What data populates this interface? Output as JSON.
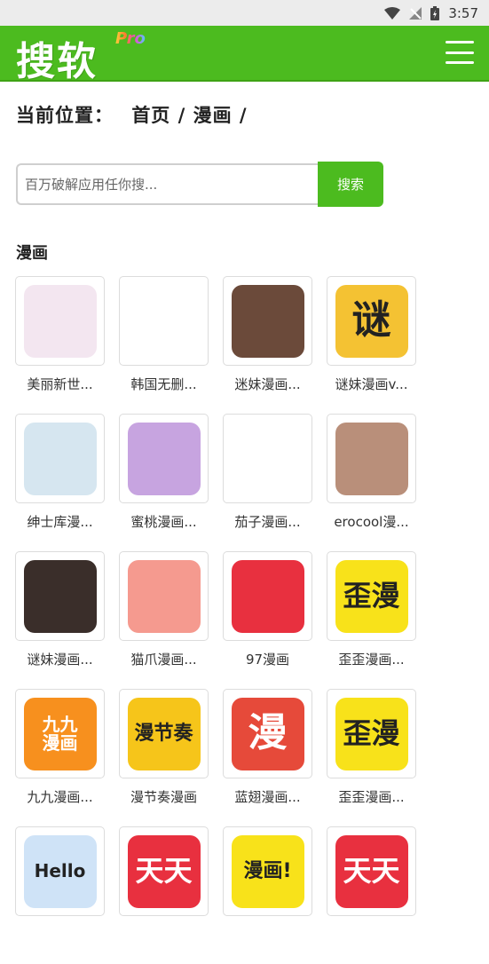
{
  "status_bar": {
    "time": "3:57"
  },
  "header": {
    "logo": "搜软",
    "logo_badge": "Pro"
  },
  "breadcrumb": {
    "prefix": "当前位置：",
    "home": "首页",
    "sep1": "/",
    "category": "漫画",
    "sep2": "/"
  },
  "search": {
    "placeholder": "百万破解应用任你搜...",
    "button": "搜索"
  },
  "section": {
    "title": "漫画"
  },
  "apps": [
    {
      "label": "美丽新世...",
      "icon": "anime-girl-white-hair-icon",
      "bg": "#f3e6f0",
      "glyph": "",
      "color": "#f3e6f0"
    },
    {
      "label": "韩国无删...",
      "icon": "korean-comic-logo-icon",
      "bg": "#ffffff",
      "glyph": "",
      "color": "#ffffff"
    },
    {
      "label": "迷妹漫画...",
      "icon": "anime-girl-library-icon",
      "bg": "#6b4a3a",
      "glyph": "",
      "color": "#6b4a3a"
    },
    {
      "label": "谜妹漫画v...",
      "icon": "mimei-monkey-logo-icon",
      "bg": "#f4c233",
      "glyph": "谜",
      "color": "#f4c233"
    },
    {
      "label": "绅士库漫...",
      "icon": "anime-girl-dark-hair-icon",
      "bg": "#d6e6f0",
      "glyph": "",
      "color": "#d6e6f0"
    },
    {
      "label": "蜜桃漫画...",
      "icon": "peach-mascot-icon",
      "bg": "#c7a4e0",
      "glyph": "",
      "color": "#c7a4e0"
    },
    {
      "label": "茄子漫画...",
      "icon": "eggplant-mascot-icon",
      "bg": "#ffffff",
      "glyph": "",
      "color": "#ffffff"
    },
    {
      "label": "erocool漫...",
      "icon": "anime-girl-uniform-icon",
      "bg": "#b98f7a",
      "glyph": "",
      "color": "#b98f7a"
    },
    {
      "label": "谜妹漫画...",
      "icon": "anime-girl-portrait-icon",
      "bg": "#3a2e2a",
      "glyph": "",
      "color": "#3a2e2a"
    },
    {
      "label": "猫爪漫画...",
      "icon": "cat-paw-icon",
      "bg": "#f59a8f",
      "glyph": "",
      "color": "#f59a8f"
    },
    {
      "label": "97漫画",
      "icon": "lightning-bolt-icon",
      "bg": "#e8303f",
      "glyph": "",
      "color": "#e8303f"
    },
    {
      "label": "歪歪漫画...",
      "icon": "waiwai-logo-icon",
      "bg": "#f8e21a",
      "glyph": "歪漫",
      "color": "#f8e21a"
    },
    {
      "label": "九九漫画...",
      "icon": "jiujiu-logo-icon",
      "bg": "#f7901e",
      "glyph": "九九\n漫画",
      "color": "#f7901e"
    },
    {
      "label": "漫节奏漫画",
      "icon": "manjiezou-logo-icon",
      "bg": "#f6c51a",
      "glyph": "漫节奏",
      "color": "#f6c51a"
    },
    {
      "label": "蓝翅漫画...",
      "icon": "man-character-logo-icon",
      "bg": "#e64a3a",
      "glyph": "漫",
      "color": "#e64a3a"
    },
    {
      "label": "歪歪漫画...",
      "icon": "waiwai-logo-icon",
      "bg": "#f8e21a",
      "glyph": "歪漫",
      "color": "#f8e21a"
    },
    {
      "label": "",
      "icon": "hello-anime-icon",
      "bg": "#cfe3f7",
      "glyph": "Hello",
      "color": "#cfe3f7"
    },
    {
      "label": "",
      "icon": "tiantian-logo-icon",
      "bg": "#e8303f",
      "glyph": "天天",
      "color": "#e8303f"
    },
    {
      "label": "",
      "icon": "manhua-exclaim-logo-icon",
      "bg": "#f8e21a",
      "glyph": "漫画!",
      "color": "#f8e21a"
    },
    {
      "label": "",
      "icon": "tiantian-logo-icon",
      "bg": "#e8303f",
      "glyph": "天天",
      "color": "#e8303f"
    }
  ]
}
